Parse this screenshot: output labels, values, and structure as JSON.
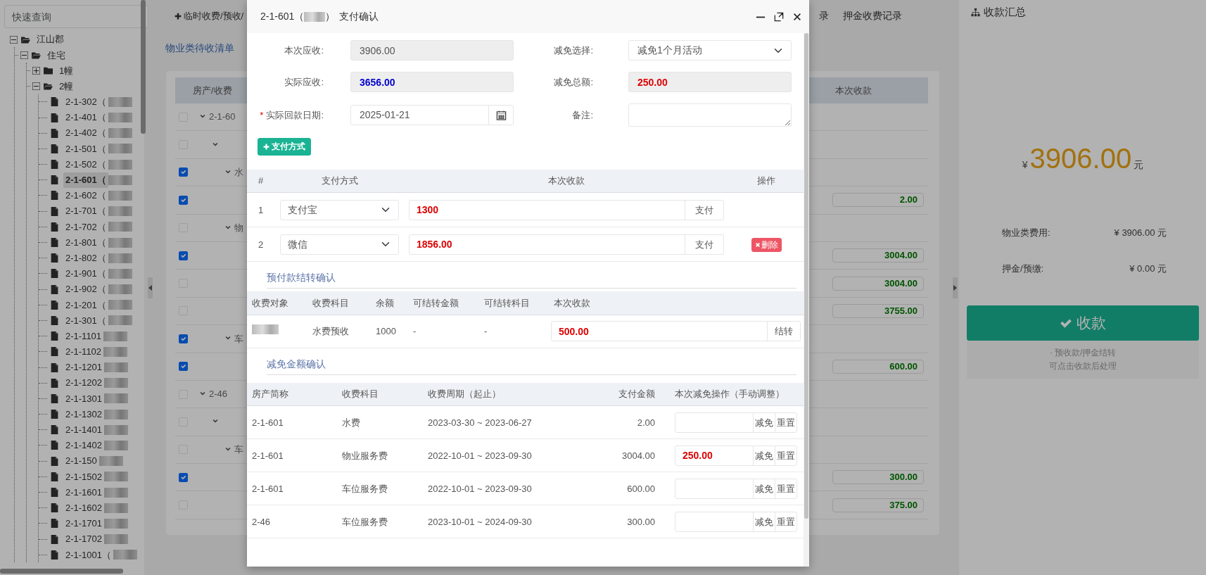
{
  "sidebar": {
    "search": {
      "placeholder": "快速查询"
    },
    "tree": [
      {
        "label": "江山郡",
        "expanded": true,
        "children": [
          {
            "label": "住宅",
            "expanded": true,
            "children": [
              {
                "label": "1幢",
                "expanded": false
              },
              {
                "label": "2幢",
                "expanded": true,
                "children": [
                  {
                    "label": "2-1-302（",
                    "selected": false
                  },
                  {
                    "label": "2-1-401（",
                    "selected": false
                  },
                  {
                    "label": "2-1-402（",
                    "selected": false
                  },
                  {
                    "label": "2-1-501（",
                    "selected": false
                  },
                  {
                    "label": "2-1-502（",
                    "selected": false
                  },
                  {
                    "label": "2-1-601（",
                    "selected": true
                  },
                  {
                    "label": "2-1-602（",
                    "selected": false
                  },
                  {
                    "label": "2-1-701（",
                    "selected": false
                  },
                  {
                    "label": "2-1-702（",
                    "selected": false
                  },
                  {
                    "label": "2-1-801（",
                    "selected": false
                  },
                  {
                    "label": "2-1-802（",
                    "selected": false
                  },
                  {
                    "label": "2-1-901（",
                    "selected": false
                  },
                  {
                    "label": "2-1-902（",
                    "selected": false
                  },
                  {
                    "label": "2-1-201（",
                    "selected": false
                  },
                  {
                    "label": "2-1-301（",
                    "selected": false
                  },
                  {
                    "label": "2-1-1101",
                    "selected": false
                  },
                  {
                    "label": "2-1-1102",
                    "selected": false
                  },
                  {
                    "label": "2-1-1201",
                    "selected": false
                  },
                  {
                    "label": "2-1-1202",
                    "selected": false
                  },
                  {
                    "label": "2-1-1301",
                    "selected": false
                  },
                  {
                    "label": "2-1-1302",
                    "selected": false
                  },
                  {
                    "label": "2-1-1401",
                    "selected": false
                  },
                  {
                    "label": "2-1-1402",
                    "selected": false
                  },
                  {
                    "label": "2-1-150",
                    "selected": false
                  },
                  {
                    "label": "2-1-1502",
                    "selected": false
                  },
                  {
                    "label": "2-1-1601",
                    "selected": false
                  },
                  {
                    "label": "2-1-1602",
                    "selected": false
                  },
                  {
                    "label": "2-1-1701",
                    "selected": false
                  },
                  {
                    "label": "2-1-1702",
                    "selected": false
                  },
                  {
                    "label": "2-1-1001（",
                    "selected": false
                  }
                ]
              }
            ]
          }
        ]
      }
    ]
  },
  "toolbar": {
    "actions": [
      {
        "label": "临时收费/预收/",
        "kind": "button"
      },
      {
        "label": "录",
        "kind": "link"
      },
      {
        "label": "押金收费记录",
        "kind": "link"
      }
    ]
  },
  "list_title": "物业类待收清单",
  "pending": {
    "columns": [
      "房产/收费",
      "本次收款"
    ],
    "rows": [
      {
        "label": "2-1-60",
        "checked": false,
        "expanded": true,
        "children": [
          {
            "checked": false,
            "expanded": true,
            "children": [
              {
                "label": "水",
                "checked": true,
                "expanded": true,
                "children": [
                  {
                    "amount": "2.00",
                    "checked": true
                  }
                ]
              },
              {
                "label": "物",
                "checked": false,
                "expanded": true,
                "children": [
                  {
                    "amount": "3004.00",
                    "checked": true
                  },
                  {
                    "amount": "3004.00",
                    "checked": false
                  },
                  {
                    "amount": "3755.00",
                    "checked": false
                  }
                ]
              },
              {
                "label": "车",
                "checked": true,
                "expanded": true,
                "children": [
                  {
                    "amount": "600.00",
                    "checked": true
                  }
                ]
              }
            ]
          }
        ]
      },
      {
        "label": "2-46",
        "checked": false,
        "expanded": true,
        "children": [
          {
            "checked": false,
            "expanded": true,
            "children": [
              {
                "label": "车",
                "checked": false,
                "expanded": true,
                "children": [
                  {
                    "amount": "300.00",
                    "checked": true
                  },
                  {
                    "amount": "375.00",
                    "checked": false
                  }
                ]
              }
            ]
          }
        ]
      }
    ]
  },
  "summary": {
    "title": "收款汇总",
    "currency": "¥",
    "total": "3906.00",
    "unit": "元",
    "lines": [
      {
        "label": "物业类费用:",
        "value": "¥ 3906.00 元"
      },
      {
        "label": "押金/预缴:",
        "value": "¥ 0.00 元"
      }
    ],
    "button": "收款",
    "notes": [
      "· 预收款/押金结转",
      "可点击收款后处理"
    ]
  },
  "modal": {
    "title_prefix": "2-1-601（",
    "title_suffix": "）",
    "title": "支付确认",
    "fields": [
      {
        "label": "本次应收:",
        "kind": "readonly",
        "value": "3906.00"
      },
      {
        "label": "减免选择:",
        "kind": "select",
        "value": "减免1个月活动"
      },
      {
        "label": "实际应收:",
        "kind": "readonly",
        "value": "3656.00",
        "color": "#0000cc"
      },
      {
        "label": "减免总额:",
        "kind": "readonly",
        "value": "250.00",
        "color": "#dd0000"
      },
      {
        "label": "实际回款日期:",
        "marker": "*",
        "kind": "date",
        "value": "2025-01-21"
      },
      {
        "label": "备注:",
        "kind": "textarea"
      }
    ],
    "add_button": "支付方式",
    "payments": {
      "columns": [
        "#",
        "支付方式",
        "本次收款",
        "操作"
      ],
      "rows": [
        {
          "index": "1",
          "method": "支付宝",
          "amount": "1300",
          "pay_button": "支付"
        },
        {
          "index": "2",
          "method": "微信",
          "amount": "1856.00",
          "pay_button": "支付",
          "delete_button": "删除"
        }
      ]
    },
    "prepay": {
      "title": "预付款结转确认",
      "columns": [
        "收费对象",
        "收费科目",
        "余额",
        "可结转金额",
        "可结转科目",
        "本次收款"
      ],
      "rows": [
        {
          "redacted": true,
          "subject": "水费预收",
          "balance": "1000",
          "transferable_amount": "-",
          "transferable_subject": "-",
          "amount": "500.00",
          "button": "结转"
        }
      ]
    },
    "discount": {
      "title": "减免金额确认",
      "columns": [
        "房产简称",
        "收费科目",
        "收费周期（起止）",
        "支付金额",
        "本次减免操作（手动调整）"
      ],
      "rows": [
        {
          "property": "2-1-601",
          "subject": "水费",
          "period": "2023-03-30 ~ 2023-06-27",
          "paid": "2.00",
          "apply_button": "减免",
          "reset_button": "重置"
        },
        {
          "property": "2-1-601",
          "subject": "物业服务费",
          "period": "2022-10-01 ~ 2023-09-30",
          "paid": "3004.00",
          "discount": "250.00",
          "apply_button": "减免",
          "reset_button": "重置"
        },
        {
          "property": "2-1-601",
          "subject": "车位服务费",
          "period": "2022-10-01 ~ 2023-09-30",
          "paid": "600.00",
          "apply_button": "减免",
          "reset_button": "重置"
        },
        {
          "property": "2-46",
          "subject": "车位服务费",
          "period": "2023-10-01 ~ 2024-09-30",
          "paid": "300.00",
          "apply_button": "减免",
          "reset_button": "重置"
        }
      ]
    }
  }
}
